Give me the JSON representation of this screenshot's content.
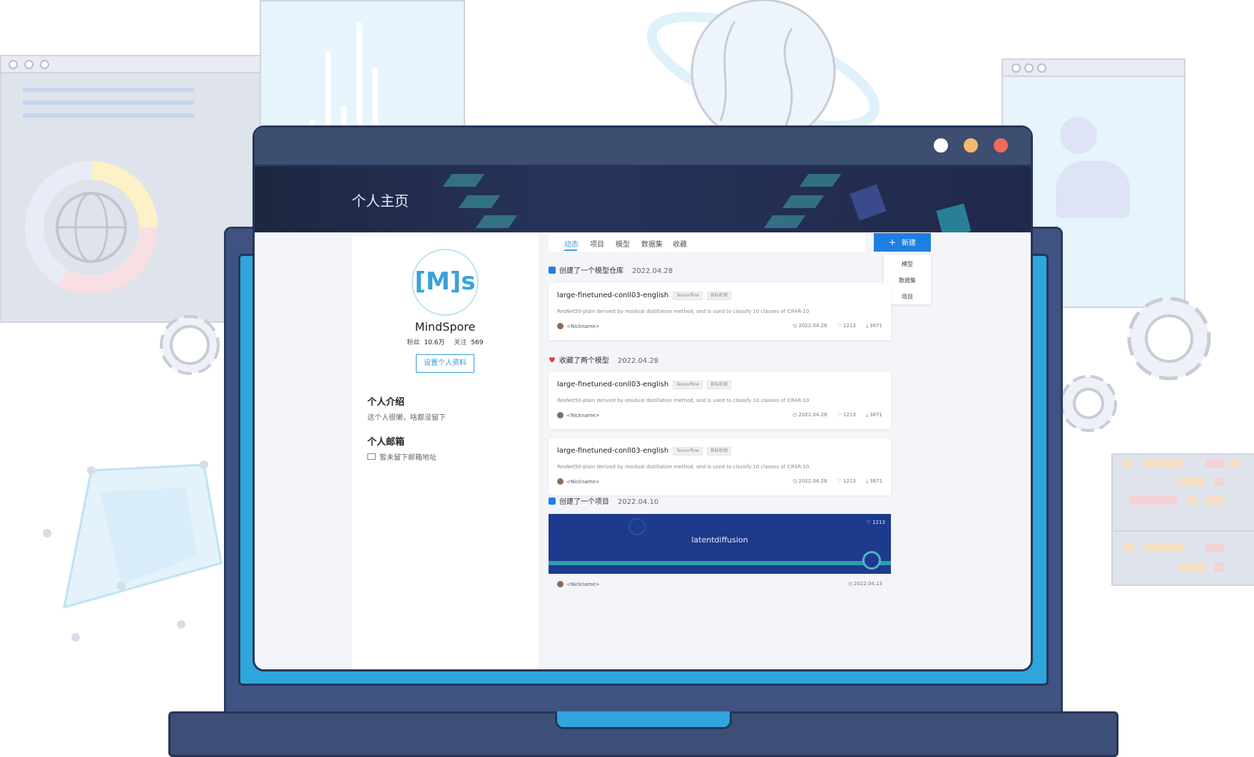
{
  "browser": {
    "window_buttons": [
      {
        "name": "white",
        "color": "#ffffff"
      },
      {
        "name": "yellow",
        "color": "#f4b96c"
      },
      {
        "name": "red",
        "color": "#ef6b5b"
      }
    ]
  },
  "header": {
    "title": "个人主页"
  },
  "profile": {
    "avatar_text": "[M]s",
    "name": "MindSpore",
    "followers_label": "粉丝",
    "followers_value": "10.6万",
    "following_label": "关注",
    "following_value": "569",
    "edit_button": "设置个人资料",
    "intro_title": "个人介绍",
    "intro_text": "这个人很懒，啥都没留下",
    "email_title": "个人邮箱",
    "email_text": "暂未留下邮箱地址"
  },
  "tabs": [
    {
      "label": "动态",
      "active": true
    },
    {
      "label": "项目",
      "active": false
    },
    {
      "label": "模型",
      "active": false
    },
    {
      "label": "数据集",
      "active": false
    },
    {
      "label": "收藏",
      "active": false
    }
  ],
  "new_button": {
    "icon": "plus-icon",
    "label": "新建"
  },
  "new_dropdown": [
    "模型",
    "数据集",
    "项目"
  ],
  "feed": [
    {
      "action": "创建了一个模型仓库",
      "icon": "repo-icon",
      "date": "2022.04.28",
      "cards": [
        {
          "title": "large-finetuned-conll03-english",
          "tags": [
            "Tensorflow",
            "目标检测"
          ],
          "desc": "ResNet50-plain derived by residual distillation method, and is used to classify 10 classes of CIFAR-10",
          "user": "<Nickname>",
          "date": "2022.04.28",
          "likes": "1213",
          "downloads": "3871"
        }
      ]
    },
    {
      "action": "收藏了两个模型",
      "icon": "heart-icon",
      "date": "2022.04.28",
      "cards": [
        {
          "title": "large-finetuned-conll03-english",
          "tags": [
            "Tensorflow",
            "目标检测"
          ],
          "desc": "ResNet50-plain derived by residual distillation method, and is used to classify 10 classes of CIFAR-10",
          "user": "<Nickname>",
          "date": "2022.04.28",
          "likes": "1213",
          "downloads": "3871"
        },
        {
          "title": "large-finetuned-conll03-english",
          "tags": [
            "Tensorflow",
            "目标检测"
          ],
          "desc": "ResNet50-plain derived by residual distillation method, and is used to classify 10 classes of CIFAR-10",
          "user": "<Nickname>",
          "date": "2022.04.28",
          "likes": "1213",
          "downloads": "3871"
        }
      ]
    },
    {
      "action": "创建了一个项目",
      "icon": "repo-icon",
      "date": "2022.04.10",
      "project": {
        "title": "latentdiffusion",
        "likes": "1213",
        "user": "<Nickname>",
        "date": "2022.04.13"
      }
    }
  ]
}
